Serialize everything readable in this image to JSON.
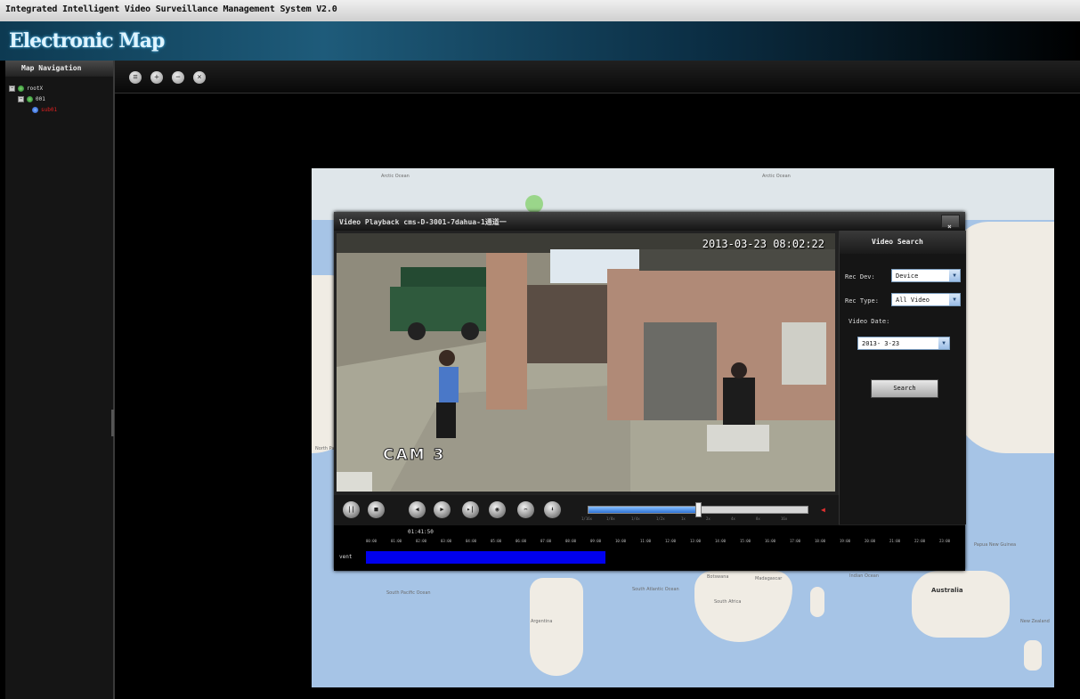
{
  "window": {
    "title": "Integrated Intelligent Video Surveillance Management System V2.0"
  },
  "banner": {
    "title": "Electronic Map"
  },
  "navigation": {
    "header": "Map Navigation",
    "nodes": [
      {
        "label": "rootX"
      },
      {
        "label": "001"
      },
      {
        "label": "sub01"
      }
    ]
  },
  "toolbar": {
    "buttons": [
      "restore",
      "zoom-in",
      "zoom-out",
      "close"
    ]
  },
  "map": {
    "labels": [
      "Arctic Ocean",
      "Arctic Ocean",
      "North Pacific",
      "South Pacific Ocean",
      "South Atlantic Ocean",
      "Indian Ocean",
      "Australia",
      "Argentina",
      "Botswana",
      "Madagascar",
      "South Africa",
      "Papua New Guinea",
      "New Zealand"
    ]
  },
  "playback": {
    "title": "Video Playback cms-D-3001-7dahua-1通道一",
    "osd_time": "2013-03-23 08:02:22",
    "osd_cam": "CAM 3",
    "current_time": "01:41:50",
    "progress": 0.5,
    "speeds": [
      "1/16x",
      "1/8x",
      "1/4x",
      "1/2x",
      "1x",
      "2x",
      "4x",
      "8x",
      "16x"
    ],
    "hours": [
      "00:00",
      "01:00",
      "02:00",
      "03:00",
      "04:00",
      "05:00",
      "06:00",
      "07:00",
      "08:00",
      "09:00",
      "10:00",
      "11:00",
      "12:00",
      "13:00",
      "14:00",
      "15:00",
      "16:00",
      "17:00",
      "18:00",
      "19:00",
      "20:00",
      "21:00",
      "22:00",
      "23:00"
    ],
    "channel": "vent",
    "record_fraction": 0.4,
    "colors": {
      "record": "#0000ee",
      "accent": "#2f73d6"
    }
  },
  "search_panel": {
    "title": "Video Search",
    "rec_dev_label": "Rec Dev:",
    "rec_dev_value": "Device",
    "rec_type_label": "Rec Type:",
    "rec_type_value": "All Video",
    "video_date_label": "Video Date:",
    "video_date_value": "2013- 3-23",
    "search_button": "Search"
  }
}
